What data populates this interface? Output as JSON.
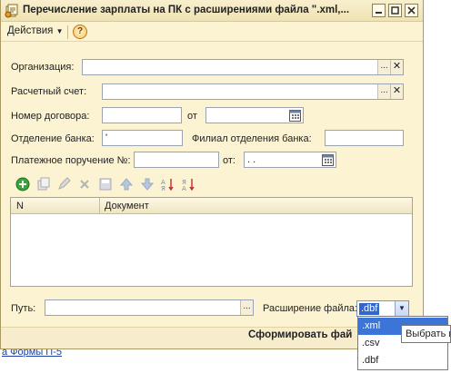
{
  "window": {
    "title": "Перечисление зарплаты на ПК с расширениями файла \".xml,..."
  },
  "menu": {
    "actions_label": "Действия",
    "help_label": "?"
  },
  "form": {
    "organization_label": "Организация:",
    "organization_value": "",
    "account_label": "Расчетный счет:",
    "account_value": "",
    "contract_number_label": "Номер договора:",
    "contract_number_value": "",
    "contract_date_label": "от",
    "contract_date_value": "",
    "bank_branch_label": "Отделение банка:",
    "bank_branch_value": "'",
    "bank_subbranch_label": "Филиал отделения банка:",
    "bank_subbranch_value": "",
    "payment_order_label": "Платежное поручение №:",
    "payment_order_value": "",
    "payment_date_label": "от:",
    "payment_date_value": " .  .",
    "browse_label": "...",
    "clear_label": "✕"
  },
  "table": {
    "columns": [
      "N",
      "Документ"
    ],
    "rows": []
  },
  "bottom": {
    "path_label": "Путь:",
    "path_value": "",
    "extension_label": "Расширение файла:",
    "extension_value": ".dbf",
    "extension_options": [
      ".xml",
      ".csv",
      ".dbf"
    ],
    "highlighted_option": ".xml",
    "tooltip": "Выбрать и"
  },
  "footer": {
    "generate_label": "Сформировать фай"
  },
  "background": {
    "link_text": "а Формы П-5"
  },
  "colors": {
    "window_bg": "#fbf3d2",
    "selection": "#3c74d8",
    "link": "#1a3fa0"
  }
}
